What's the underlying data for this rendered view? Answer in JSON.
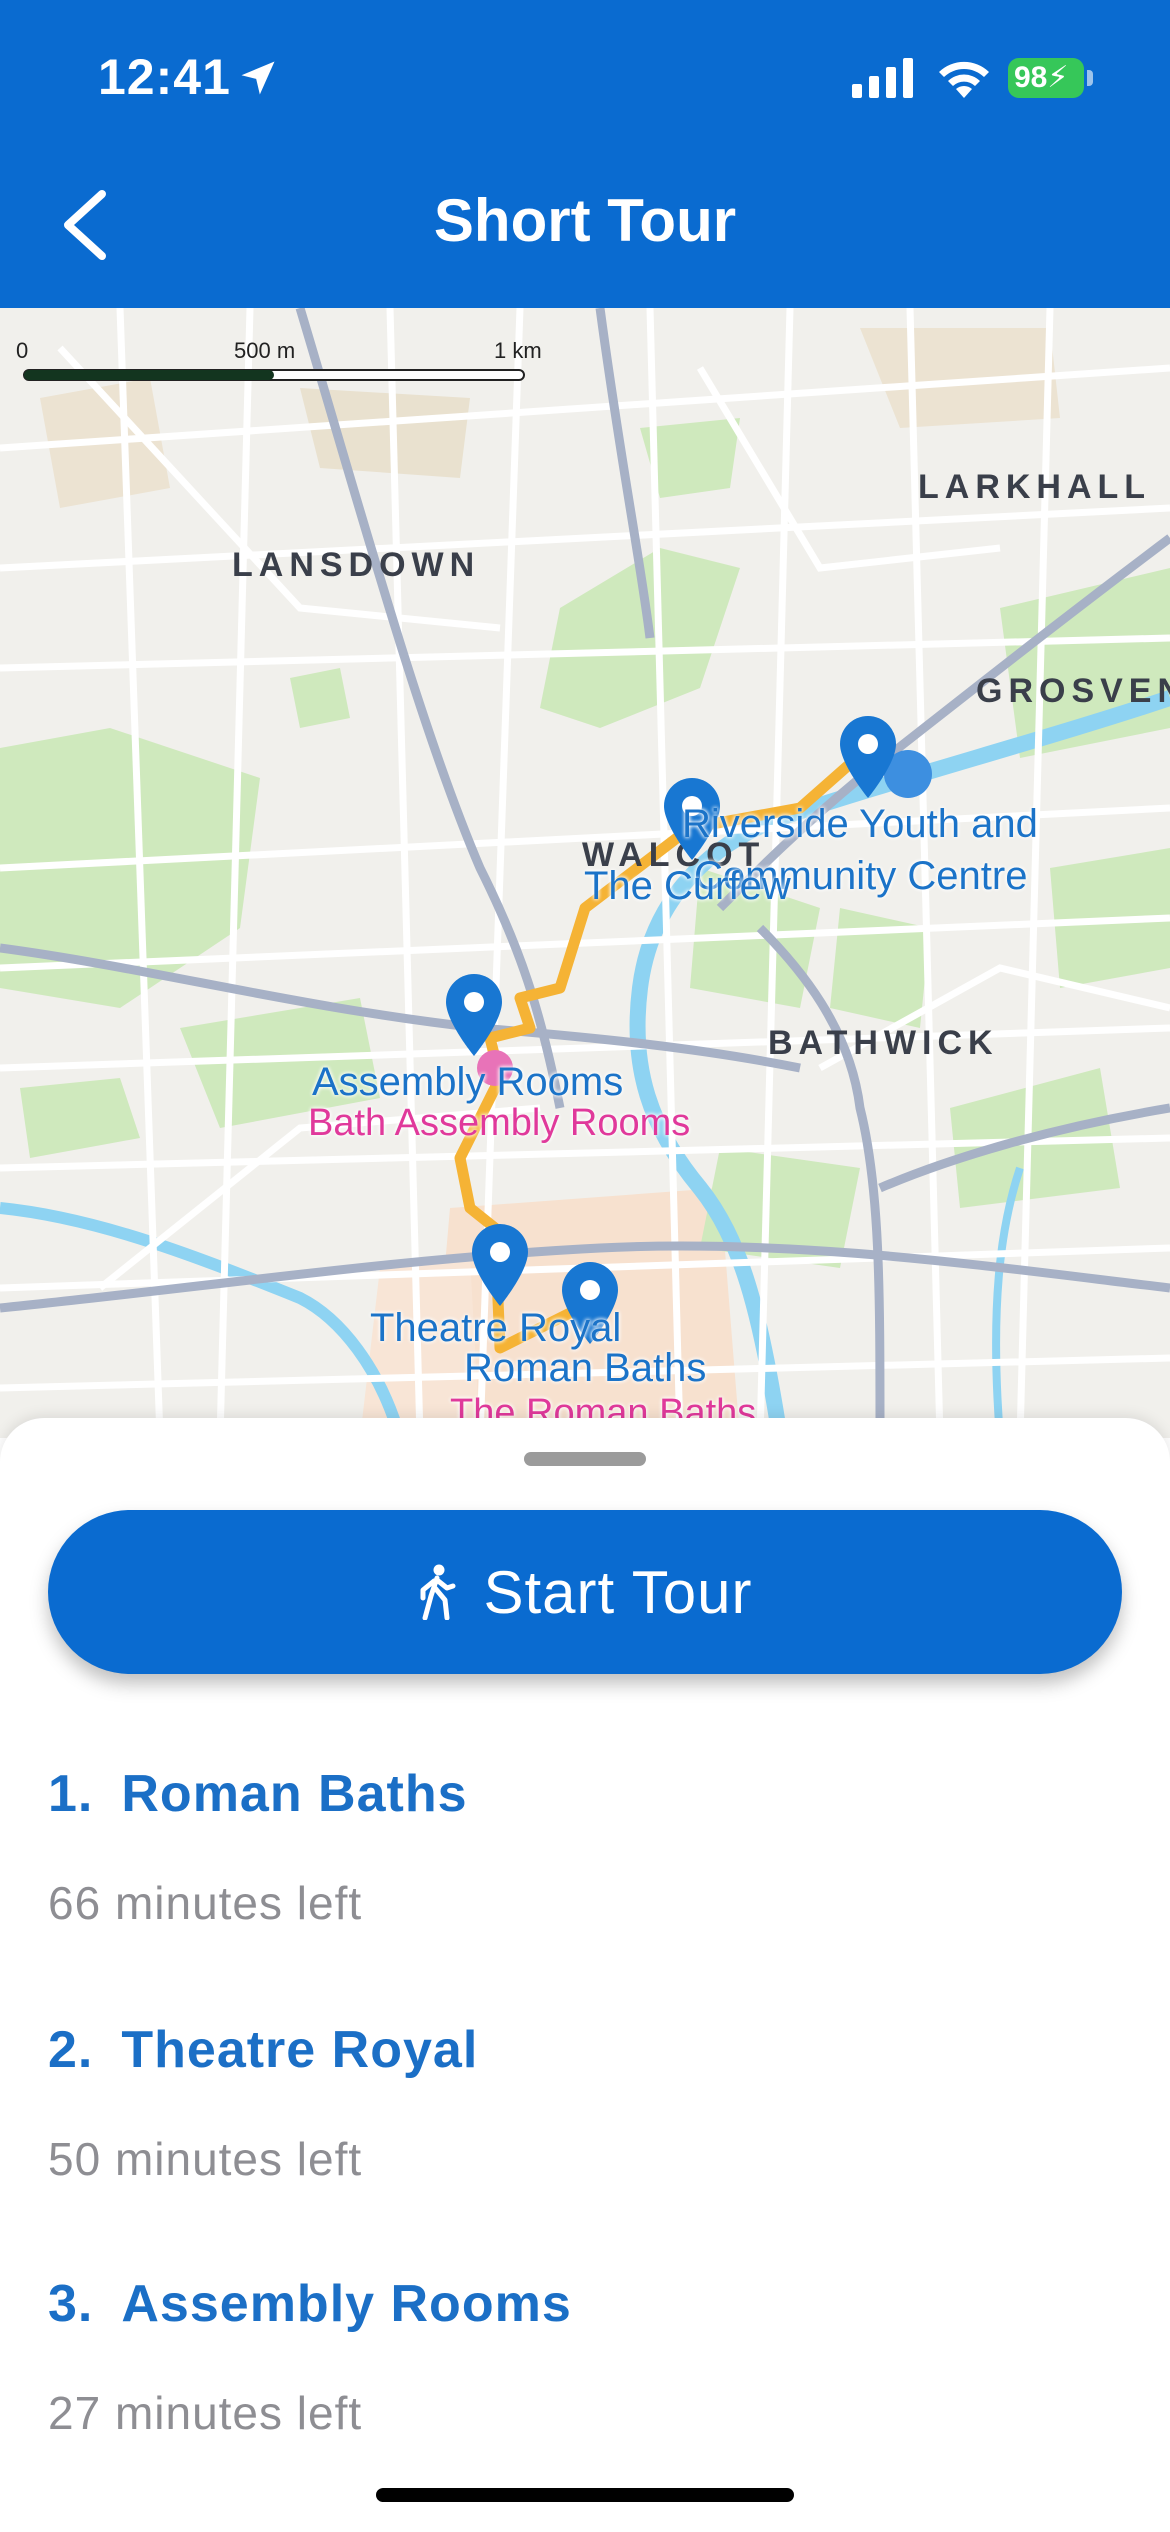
{
  "status_bar": {
    "time": "12:41",
    "battery": "98"
  },
  "nav": {
    "title": "Short Tour",
    "back_icon": "chevron-left-icon"
  },
  "map": {
    "scale": {
      "zero": "0",
      "mid": "500 m",
      "max": "1 km"
    },
    "areas": {
      "larkhall": "LARKHALL",
      "lansdown": "LANSDOWN",
      "grosvenor": "GROSVEN",
      "walcot": "WALCOT",
      "bathwick": "BATHWICK"
    },
    "pois": {
      "riverside_1": "Riverside Youth and",
      "riverside_2": "Community Centre",
      "curfew": "The Curfew",
      "assembly": "Assembly Rooms",
      "bath_assembly": "Bath Assembly Rooms",
      "theatre": "Theatre Royal",
      "roman": "Roman Baths",
      "the_roman": "The Roman Baths"
    },
    "colors": {
      "route": "#f5b335",
      "pin": "#1877d2",
      "water": "#8ed3f2",
      "park": "#cfe9bd"
    }
  },
  "sheet": {
    "start_button": "Start Tour",
    "stops": [
      {
        "num": "1.",
        "name": "Roman Baths",
        "time": "66 minutes left"
      },
      {
        "num": "2.",
        "name": "Theatre Royal",
        "time": "50 minutes left"
      },
      {
        "num": "3.",
        "name": "Assembly Rooms",
        "time": "27 minutes left"
      }
    ]
  }
}
